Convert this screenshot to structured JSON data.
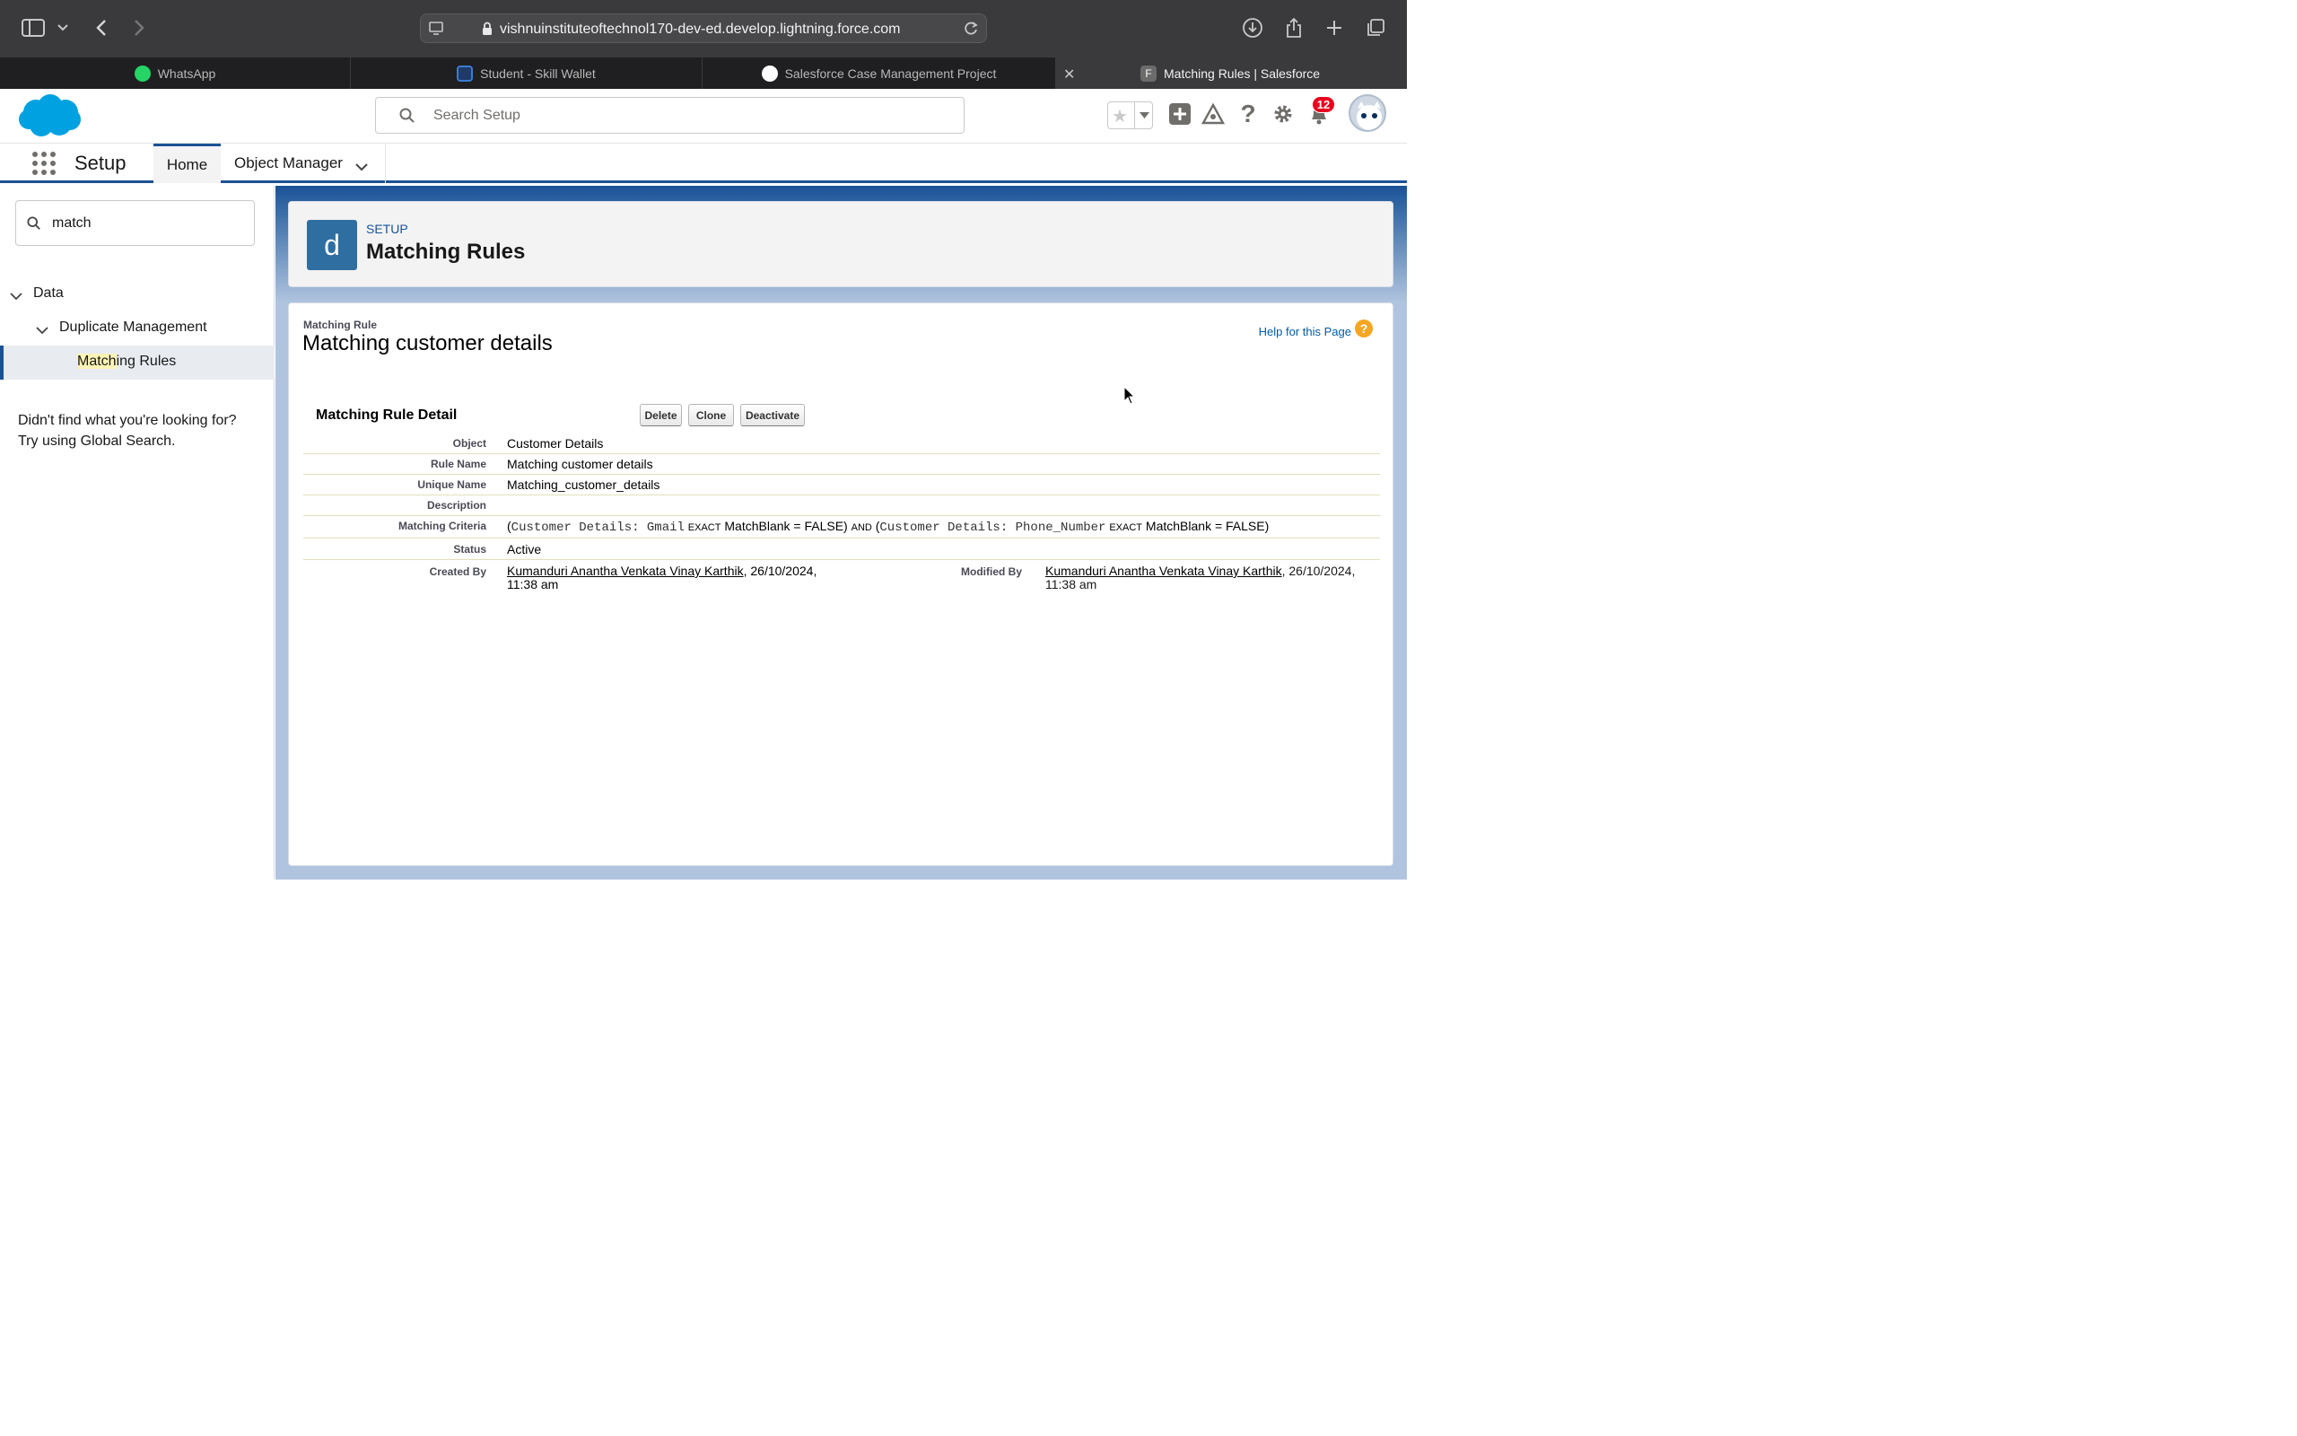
{
  "browser": {
    "url": "vishnuinstituteoftechnol170-dev-ed.develop.lightning.force.com",
    "tabs": [
      {
        "label": "WhatsApp",
        "icon": "whatsapp-icon",
        "color": "#25d366"
      },
      {
        "label": "Student - Skill Wallet",
        "icon": "skill-wallet-icon",
        "color": "#2f6ea1"
      },
      {
        "label": "Salesforce Case Management Project",
        "icon": "openai-icon",
        "color": "#ffffff"
      },
      {
        "label": "Matching Rules | Salesforce",
        "icon": "salesforce-f-icon",
        "color": "#6b6b6b"
      }
    ]
  },
  "header": {
    "search_placeholder": "Search Setup",
    "notification_count": "12"
  },
  "nav": {
    "app_name": "Setup",
    "home_tab": "Home",
    "object_manager_tab": "Object Manager"
  },
  "sidebar": {
    "quick_find_value": "match",
    "tree": {
      "data": "Data",
      "duplicate_management": "Duplicate Management",
      "matching_rules_highlight": "Match",
      "matching_rules_rest": "ing Rules"
    },
    "no_find_line1": "Didn't find what you're looking for?",
    "no_find_line2": "Try using Global Search."
  },
  "page_header": {
    "icon_letter": "d",
    "kicker": "SETUP",
    "title": "Matching Rules"
  },
  "record": {
    "type_label": "Matching Rule",
    "title": "Matching customer details",
    "help_link": "Help for this Page",
    "section_title": "Matching Rule Detail",
    "buttons": {
      "delete": "Delete",
      "clone": "Clone",
      "deactivate": "Deactivate"
    },
    "fields": {
      "object_label": "Object",
      "object_value": "Customer Details",
      "rule_name_label": "Rule Name",
      "rule_name_value": "Matching customer details",
      "unique_name_label": "Unique Name",
      "unique_name_value": "Matching_customer_details",
      "description_label": "Description",
      "description_value": "",
      "criteria_label": "Matching Criteria",
      "criteria": {
        "p1_open": "(",
        "p1_field": "Customer Details: Gmail",
        "p1_op": "EXACT",
        "p1_blank": "MatchBlank = FALSE)",
        "conj": "AND",
        "p2_open": "(",
        "p2_field": "Customer Details: Phone_Number",
        "p2_op": "EXACT",
        "p2_blank": "MatchBlank = FALSE)"
      },
      "status_label": "Status",
      "status_value": "Active",
      "created_by_label": "Created By",
      "created_by_name": "Kumanduri Anantha Venkata Vinay Karthik",
      "created_by_date": ", 26/10/2024,",
      "created_by_time": "11:38 am",
      "modified_by_label": "Modified By",
      "modified_by_name": "Kumanduri Anantha Venkata Vinay Karthik",
      "modified_by_date": ", 26/10/2024,",
      "modified_by_time": "11:38 am"
    }
  },
  "colors": {
    "brand": "#1b5297",
    "salesforce_cloud": "#00a1e0",
    "badge": "#ea001e"
  }
}
